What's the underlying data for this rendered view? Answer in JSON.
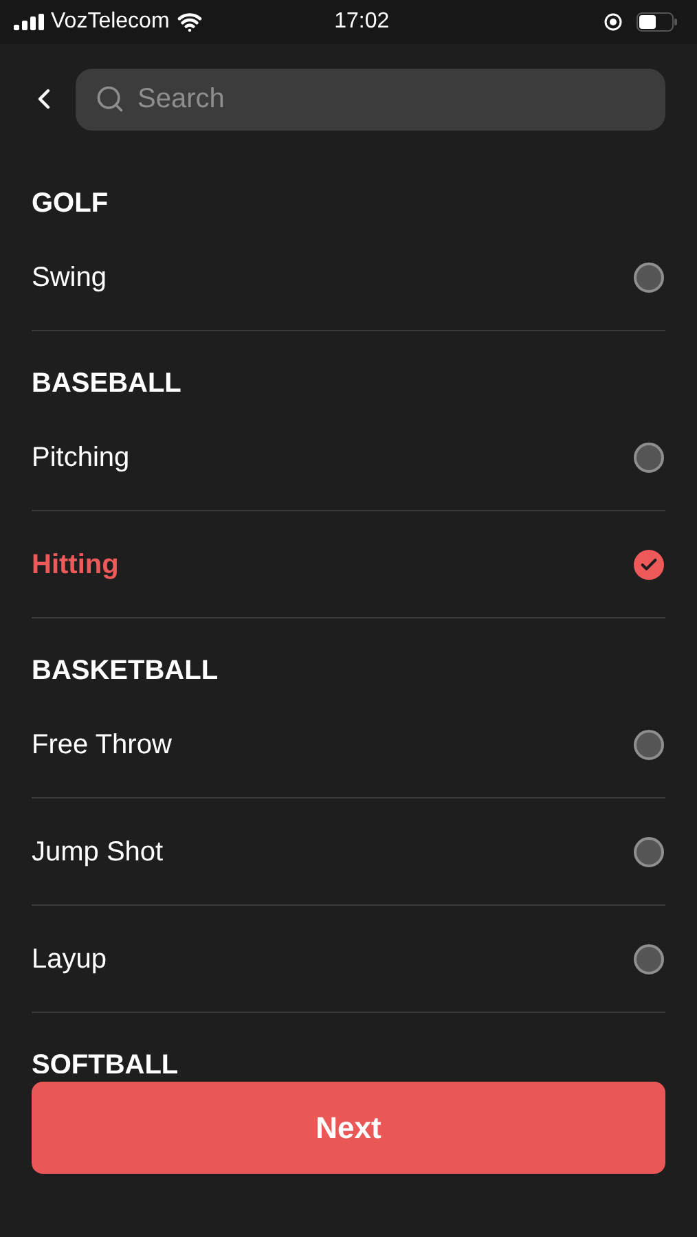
{
  "status_bar": {
    "carrier": "VozTelecom",
    "time": "17:02"
  },
  "search": {
    "placeholder": "Search"
  },
  "sections": [
    {
      "title": "GOLF",
      "items": [
        {
          "label": "Swing",
          "selected": false
        }
      ]
    },
    {
      "title": "BASEBALL",
      "items": [
        {
          "label": "Pitching",
          "selected": false
        },
        {
          "label": "Hitting",
          "selected": true
        }
      ]
    },
    {
      "title": "BASKETBALL",
      "items": [
        {
          "label": "Free Throw",
          "selected": false
        },
        {
          "label": "Jump Shot",
          "selected": false
        },
        {
          "label": "Layup",
          "selected": false
        }
      ]
    },
    {
      "title": "SOFTBALL"
    }
  ],
  "next_button": {
    "label": "Next"
  }
}
